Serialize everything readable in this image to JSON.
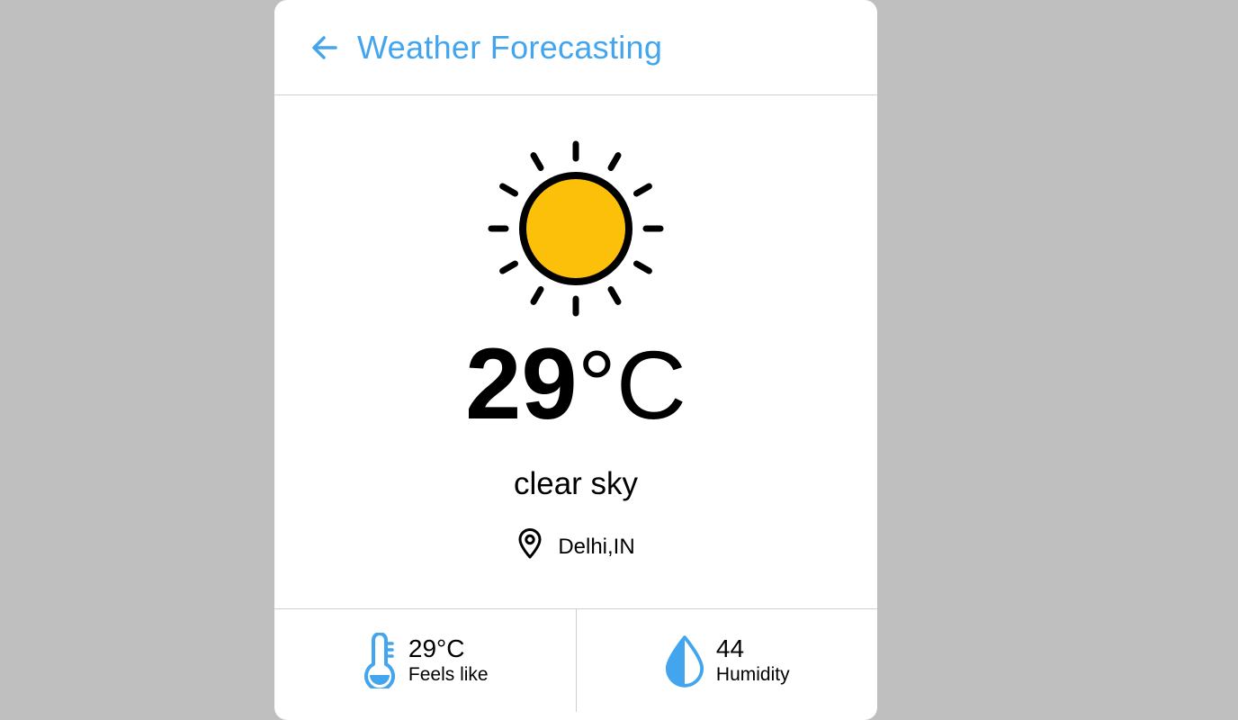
{
  "header": {
    "title": "Weather Forecasting",
    "back_icon": "arrow-left-icon"
  },
  "current": {
    "icon": "sun-icon",
    "temperature_value": "29",
    "temperature_unit": "°C",
    "description": "clear sky",
    "location_icon": "map-pin-icon",
    "location": "Delhi,IN"
  },
  "details": {
    "feels_like": {
      "icon": "thermometer-icon",
      "value": "29°C",
      "label": "Feels like"
    },
    "humidity": {
      "icon": "droplet-icon",
      "value": "44",
      "label": "Humidity"
    }
  },
  "colors": {
    "accent": "#43a5ee",
    "sun": "#fdc00a",
    "background": "#bfbfbf"
  }
}
